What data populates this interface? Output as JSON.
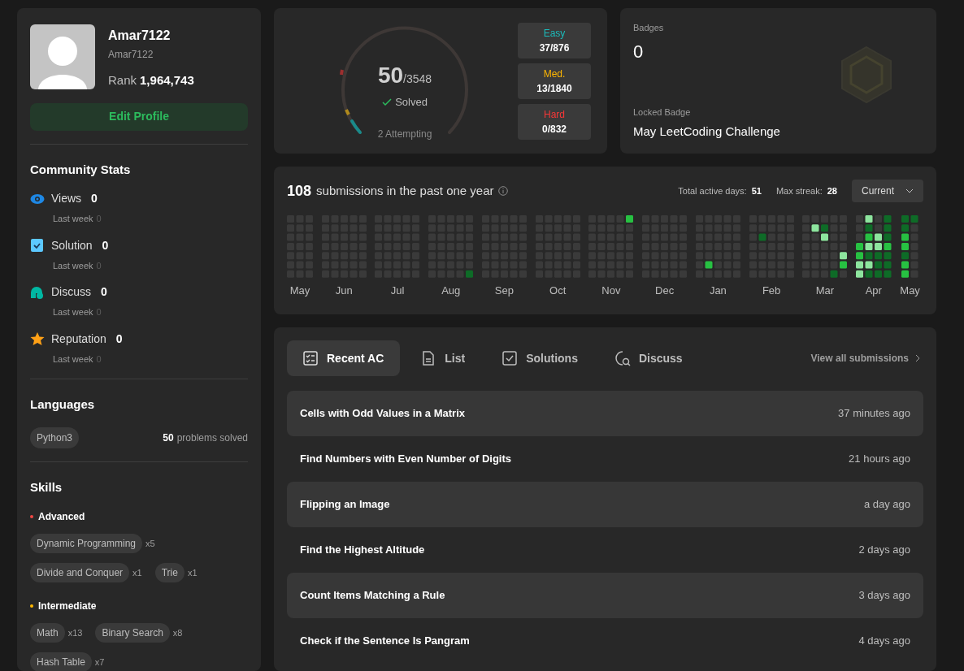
{
  "profile": {
    "display_name": "Amar7122",
    "username": "Amar7122",
    "rank_label": "Rank",
    "rank": "1,964,743",
    "edit_button": "Edit Profile"
  },
  "community_stats": {
    "title": "Community Stats",
    "items": [
      {
        "kind": "views",
        "label": "Views",
        "value": "0",
        "sub_label": "Last week",
        "sub_value": "0"
      },
      {
        "kind": "solution",
        "label": "Solution",
        "value": "0",
        "sub_label": "Last week",
        "sub_value": "0"
      },
      {
        "kind": "discuss",
        "label": "Discuss",
        "value": "0",
        "sub_label": "Last week",
        "sub_value": "0"
      },
      {
        "kind": "reputation",
        "label": "Reputation",
        "value": "0",
        "sub_label": "Last week",
        "sub_value": "0"
      }
    ]
  },
  "languages": {
    "title": "Languages",
    "items": [
      {
        "name": "Python3",
        "count": "50",
        "suffix": "problems solved"
      }
    ]
  },
  "skills": {
    "title": "Skills",
    "groups": [
      {
        "name": "Advanced",
        "color": "#ef4743",
        "tags": [
          {
            "name": "Dynamic Programming",
            "count": "x5"
          },
          {
            "name": "Divide and Conquer",
            "count": "x1"
          },
          {
            "name": "Trie",
            "count": "x1"
          }
        ]
      },
      {
        "name": "Intermediate",
        "color": "#ffb800",
        "tags": [
          {
            "name": "Math",
            "count": "x13"
          },
          {
            "name": "Binary Search",
            "count": "x8"
          },
          {
            "name": "Hash Table",
            "count": "x7"
          }
        ]
      }
    ]
  },
  "solved": {
    "count": "50",
    "total": "/3548",
    "label": "Solved",
    "attempting": "2 Attempting",
    "difficulties": [
      {
        "name": "Easy",
        "value": "37/876",
        "color": "#1cbaba"
      },
      {
        "name": "Med.",
        "value": "13/1840",
        "color": "#ffb700"
      },
      {
        "name": "Hard",
        "value": "0/832",
        "color": "#f63737"
      }
    ]
  },
  "badges": {
    "title": "Badges",
    "count": "0",
    "locked_label": "Locked Badge",
    "locked_name": "May LeetCoding Challenge"
  },
  "calendar": {
    "count": "108",
    "caption": "submissions in the past one year",
    "active_label": "Total active days:",
    "active_value": "51",
    "streak_label": "Max streak:",
    "streak_value": "28",
    "dropdown": "Current",
    "months": [
      "May",
      "Jun",
      "Jul",
      "Aug",
      "Sep",
      "Oct",
      "Nov",
      "Dec",
      "Jan",
      "Feb",
      "Mar",
      "Apr",
      "May"
    ]
  },
  "recent": {
    "tabs": [
      {
        "kind": "recent",
        "label": "Recent AC",
        "selected": true
      },
      {
        "kind": "list",
        "label": "List",
        "selected": false
      },
      {
        "kind": "solutions",
        "label": "Solutions",
        "selected": false
      },
      {
        "kind": "discuss",
        "label": "Discuss",
        "selected": false
      }
    ],
    "view_all": "View all submissions",
    "rows": [
      {
        "title": "Cells with Odd Values in a Matrix",
        "time": "37 minutes ago"
      },
      {
        "title": "Find Numbers with Even Number of Digits",
        "time": "21 hours ago"
      },
      {
        "title": "Flipping an Image",
        "time": "a day ago"
      },
      {
        "title": "Find the Highest Altitude",
        "time": "2 days ago"
      },
      {
        "title": "Count Items Matching a Rule",
        "time": "3 days ago"
      },
      {
        "title": "Check if the Sentence Is Pangram",
        "time": "4 days ago"
      }
    ]
  }
}
